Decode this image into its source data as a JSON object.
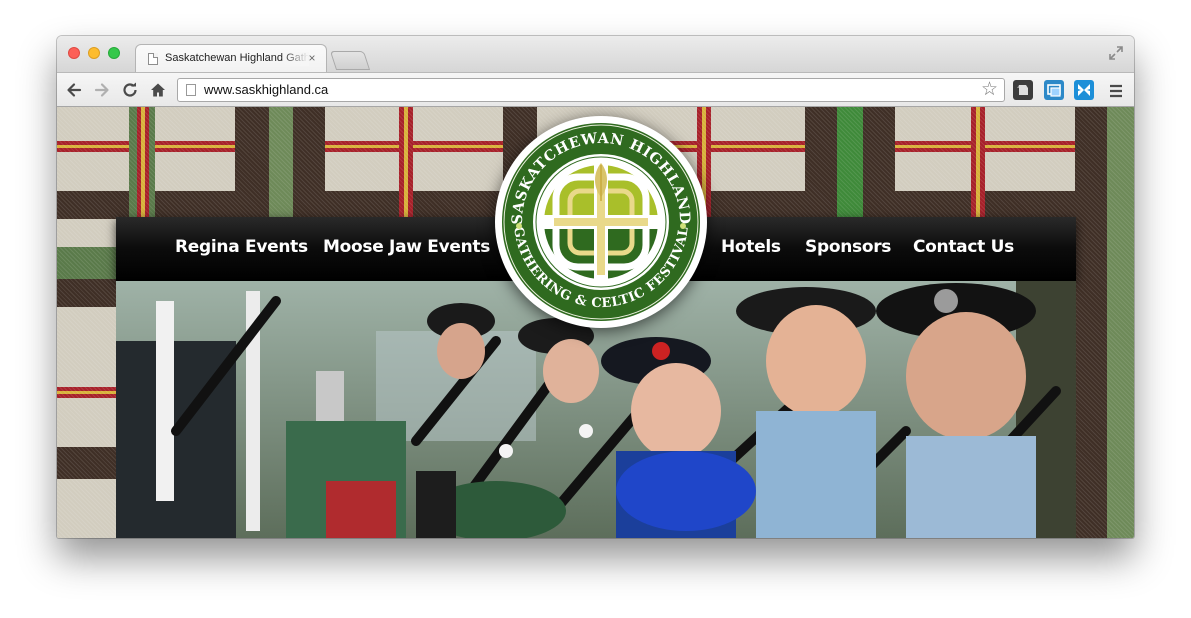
{
  "browser": {
    "tab_title": "Saskatchewan Highland Gathering & Celtic Festival",
    "tab_close": "×",
    "url": "www.saskhighland.ca"
  },
  "site": {
    "nav": [
      "Regina Events",
      "Moose Jaw Events",
      "Hotels",
      "Sponsors",
      "Contact Us"
    ],
    "logo": {
      "top_text": "SASKATCHEWAN HIGHLAND",
      "bottom_text": "GATHERING & CELTIC FESTIVAL"
    }
  },
  "icons": {
    "back": "arrow-left-icon",
    "forward": "arrow-right-icon",
    "reload": "reload-icon",
    "home": "home-icon",
    "bookmark": "star-icon",
    "menu": "hamburger-menu-icon"
  },
  "colors": {
    "logo_green": "#2f6a1f",
    "logo_lime": "#a9bf2a",
    "logo_gold": "#e9d98a",
    "nav_bg": "#0c0c0c"
  }
}
